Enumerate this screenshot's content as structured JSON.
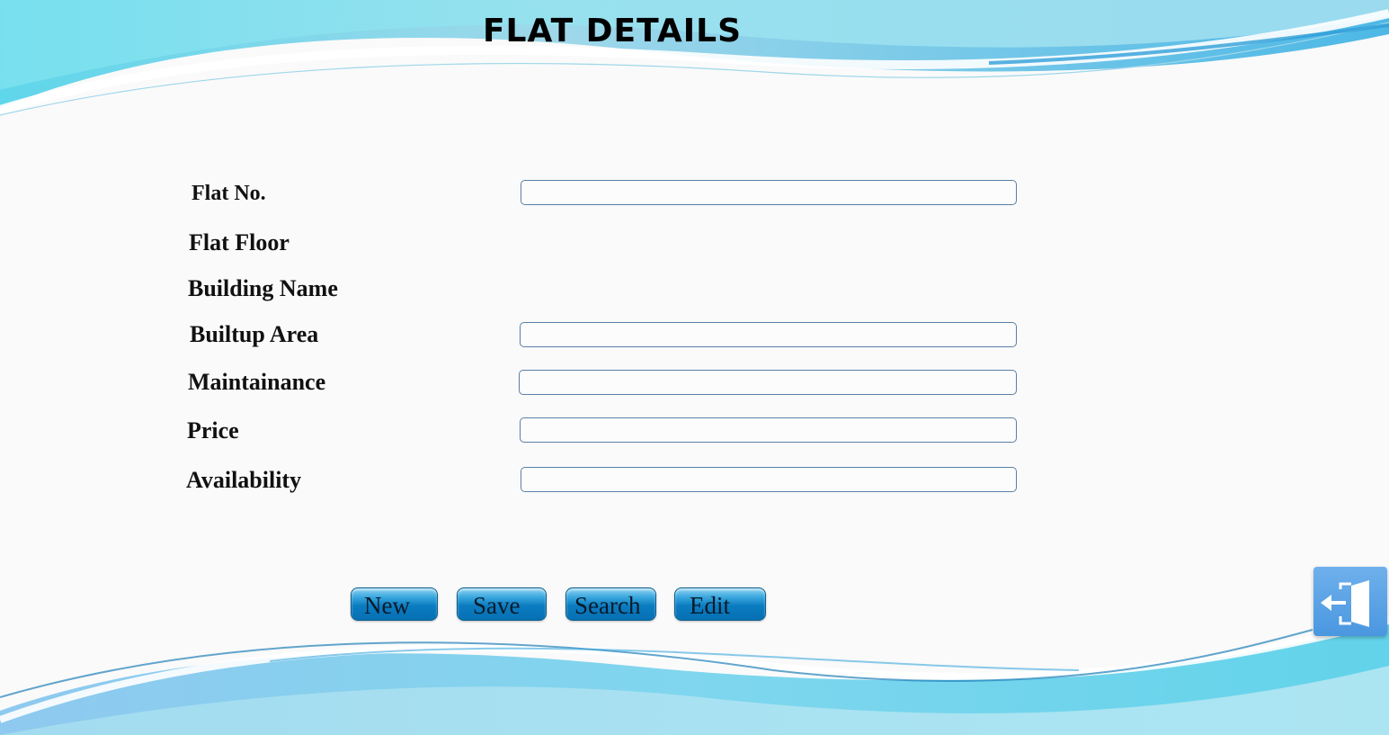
{
  "page": {
    "title": "FLAT DETAILS"
  },
  "form": {
    "fields": [
      {
        "label": "Flat No.",
        "value": ""
      },
      {
        "label": "Flat Floor"
      },
      {
        "label": "Building Name"
      },
      {
        "label": "Builtup Area",
        "value": ""
      },
      {
        "label": "Maintainance",
        "value": ""
      },
      {
        "label": "Price",
        "value": ""
      },
      {
        "label": "Availability",
        "value": ""
      }
    ]
  },
  "buttons": {
    "new": "New",
    "save": "Save",
    "search": "Search",
    "edit": "Edit",
    "exit_icon": "exit-door-icon"
  },
  "colors": {
    "wave_light": "#7fd8ef",
    "wave_dark": "#3aa7de",
    "button": "#0b7cc0",
    "exit_button": "#4a97e0"
  }
}
